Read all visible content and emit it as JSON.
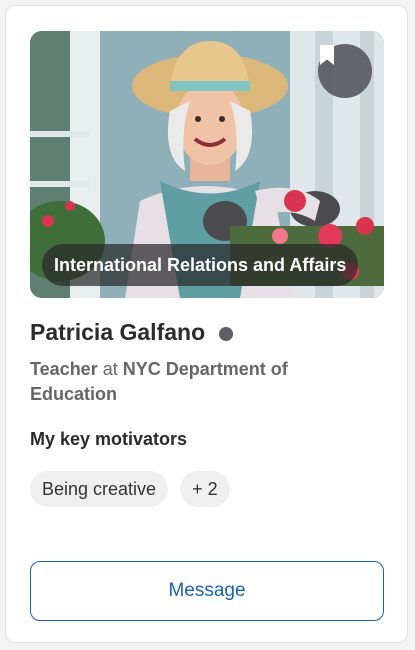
{
  "profile": {
    "field_tag": "International Relations and Affairs",
    "name": "Patricia Galfano",
    "status_color": "#5d5d66",
    "job_title": "Teacher",
    "job_connector": "at",
    "organization": "NYC Department of Education"
  },
  "motivators": {
    "title": "My key motivators",
    "chips": [
      "Being creative",
      "+ 2"
    ]
  },
  "actions": {
    "message_label": "Message",
    "bookmark_icon": "bookmark-icon"
  },
  "colors": {
    "accent": "#1b5fb8",
    "text_dark": "#2b2b2b",
    "text_muted": "#666666",
    "chip_bg": "#efefef"
  }
}
